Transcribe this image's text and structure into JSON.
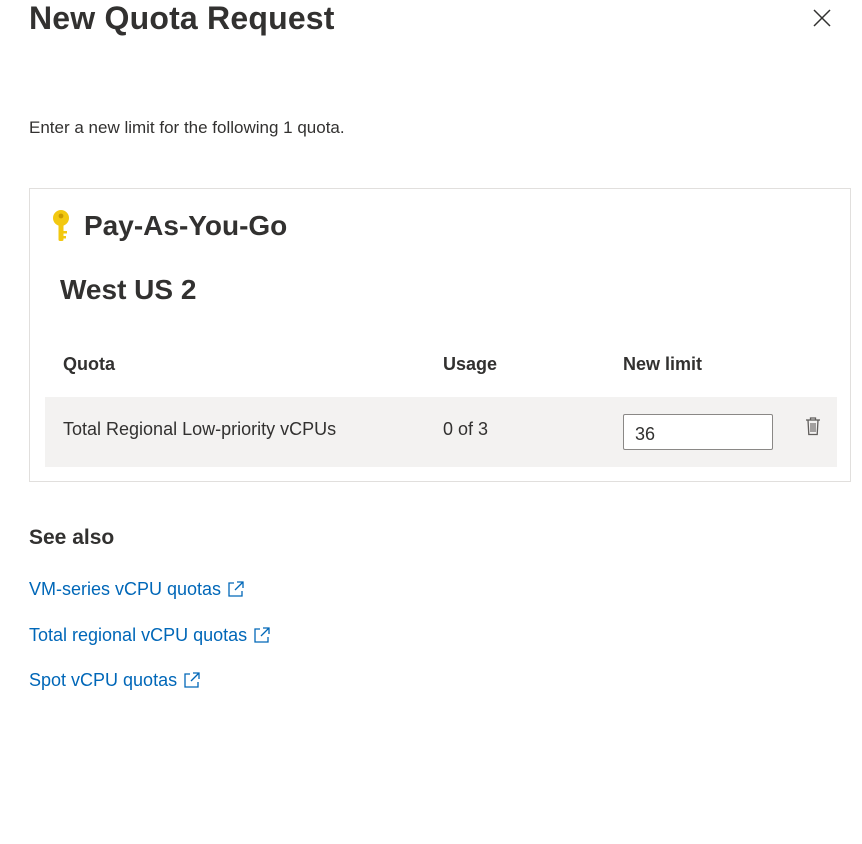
{
  "dialog": {
    "title": "New Quota Request",
    "close_icon": "close-icon",
    "intro": "Enter a new limit for the following 1 quota."
  },
  "card": {
    "subscription_icon": "key-icon",
    "subscription": "Pay-As-You-Go",
    "region": "West US 2",
    "columns": {
      "quota": "Quota",
      "usage": "Usage",
      "new_limit": "New limit"
    },
    "rows": [
      {
        "quota": "Total Regional Low-priority vCPUs",
        "usage": "0 of 3",
        "new_limit": "36",
        "delete_icon": "trash-icon"
      }
    ]
  },
  "see_also": {
    "heading": "See also",
    "links": [
      {
        "label": "VM-series vCPU quotas",
        "icon": "external-link-icon"
      },
      {
        "label": "Total regional vCPU quotas",
        "icon": "external-link-icon"
      },
      {
        "label": "Spot vCPU quotas",
        "icon": "external-link-icon"
      }
    ]
  },
  "colors": {
    "link": "#0067b8",
    "key": "#f2c811",
    "row_background": "#f3f2f1",
    "text": "#323130"
  }
}
